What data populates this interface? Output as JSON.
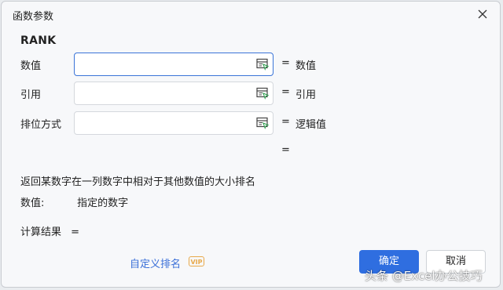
{
  "dialog": {
    "title": "函数参数",
    "function_name": "RANK"
  },
  "args": [
    {
      "label": "数值",
      "value": "",
      "result": "数值"
    },
    {
      "label": "引用",
      "value": "",
      "result": "引用"
    },
    {
      "label": "排位方式",
      "value": "",
      "result": "逻辑值"
    }
  ],
  "overall_result_eq": "=",
  "eq_sign": "=",
  "description": "返回某数字在一列数字中相对于其他数值的大小排名",
  "param_help": {
    "name": "数值:",
    "text": "指定的数字"
  },
  "calc": {
    "label": "计算结果",
    "eq": "="
  },
  "custom_link": "自定义排名",
  "vip_badge": "VIP",
  "buttons": {
    "ok": "确定",
    "cancel": "取消"
  },
  "watermark": "头条 @Excel办公技巧",
  "colors": {
    "accent": "#2f6ee0",
    "link": "#3a6fd8",
    "vip": "#e8a94a"
  }
}
